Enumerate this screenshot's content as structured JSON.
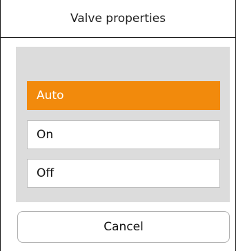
{
  "dialog": {
    "title": "Valve properties"
  },
  "options": [
    {
      "label": "Auto",
      "selected": true
    },
    {
      "label": "On",
      "selected": false
    },
    {
      "label": "Off",
      "selected": false
    }
  ],
  "actions": {
    "cancel_label": "Cancel"
  },
  "colors": {
    "selected_background": "#f28a0c",
    "panel_background": "#dcdcdc"
  }
}
